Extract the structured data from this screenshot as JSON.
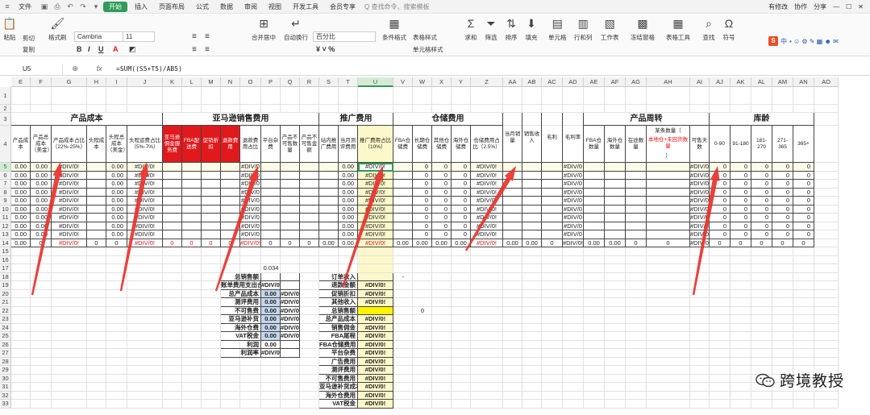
{
  "titlebar": {
    "menus": [
      "文件",
      "开始",
      "插入",
      "页面布局",
      "公式",
      "数据",
      "审阅",
      "视图",
      "开发工具",
      "会员专享"
    ],
    "active_menu": "开始",
    "search_placeholder": "Q 查找命令、搜索模板",
    "right_items": [
      "有修改",
      "协作",
      "分享"
    ]
  },
  "ribbon": {
    "paste": "粘贴",
    "cut": "剪切",
    "copy": "复制",
    "format_painter": "格式刷",
    "font_name": "Cambria",
    "font_size": "11",
    "merge": "合并居中",
    "wrap": "自动换行",
    "number_format": "百分比",
    "conditional": "条件格式",
    "table_style": "表格样式",
    "cell_style": "单元格样式",
    "sum": "求和",
    "filter": "筛选",
    "sort": "排序",
    "fill": "填充",
    "cell": "单元格",
    "row_col": "行和列",
    "worksheet": "工作表",
    "freeze": "冻结窗格",
    "table_tools": "表格工具",
    "find": "查找",
    "symbol": "符号",
    "wps_text": "中 ",
    "bold": "B",
    "italic": "I",
    "underline": "U"
  },
  "formula_bar": {
    "name_box": "U5",
    "formula": "=SUM((S5+T5)/AB5)"
  },
  "columns": [
    "E",
    "F",
    "G",
    "H",
    "I",
    "J",
    "K",
    "L",
    "M",
    "N",
    "O",
    "P",
    "Q",
    "R",
    "S",
    "T",
    "U",
    "V",
    "W",
    "X",
    "Y",
    "Z",
    "AA",
    "AB",
    "AC",
    "AD",
    "AE",
    "AF",
    "AG",
    "AH",
    "AI",
    "AJ",
    "AK",
    "AL",
    "AM",
    "AN",
    "AO"
  ],
  "rows": [
    "1",
    "2",
    "3",
    "4",
    "5",
    "6",
    "7",
    "8",
    "9",
    "10",
    "11",
    "12",
    "13",
    "14",
    "15",
    "16",
    "17",
    "18",
    "19",
    "20",
    "21",
    "22",
    "23",
    "24",
    "25",
    "26",
    "27",
    "28",
    "29",
    "30",
    "31",
    "32",
    "33"
  ],
  "headers": {
    "product_cost": "产品成本",
    "amazon_fee": "亚马逊销售费用",
    "promo_fee": "推广费用",
    "storage_fee": "仓储费用",
    "turnover": "产品周转",
    "aging": "库龄",
    "e4": "产品成本",
    "f4": "产品总成本（美金）",
    "g4": "产品成本占比（22%-25%）",
    "h4": "头程成本",
    "i4": "头程总成本（美金）",
    "j4": "头程运费占比（5%-7%）",
    "k4": "亚马逊佣金服务费",
    "l4": "FBA配送费",
    "m4": "促销折扣",
    "n4": "退款费用",
    "o4": "退款费用占比",
    "p4": "平台杂费",
    "q4": "产品不可售数量",
    "r4": "产品不可售金额",
    "s4": "站内推广费用",
    "t4": "当月测评费用",
    "u4": "推广费用占比（10%）",
    "v4": "FBA仓储费",
    "w4": "长期仓储费",
    "x4": "其他仓储费",
    "y4": "海外仓储费",
    "z4": "仓储费用占比（2.5%）",
    "aa4": "当月销量",
    "ab4": "销售收入",
    "ac4": "毛利",
    "ad4": "毛利率",
    "ae4": "FBA仓数量",
    "af4": "海外仓数量",
    "ag4": "在途数量",
    "ah4_a": "某条数量（",
    "ah4_b": "本地仓+未回货数量",
    "ah4_c": "）",
    "ai4": "可售天数",
    "aj4": "0-90",
    "ak4": "91-180",
    "al4": "181-270",
    "am4": "271-365",
    "an4": "365+"
  },
  "values": {
    "zero2": "0.00",
    "zero": "0",
    "div": "#DIV/0!",
    "div_trunc": "#DIV/0",
    "p17": "0.034"
  },
  "summary_left": {
    "labels": [
      "总销售额",
      "账单费用支出合计",
      "总产品成本",
      "测评费用",
      "不可售费",
      "亚马逊补货",
      "海外仓费",
      "VAT税金",
      "利润",
      "利润率"
    ],
    "vals": [
      "",
      "#DIV/0!",
      "0.00",
      "0.00",
      "0.00",
      "0.00",
      "0.00",
      "0.00",
      "0.00",
      "#DIV/0!"
    ],
    "vals2": [
      "",
      "",
      "#DIV/0!",
      "#DIV/0!",
      "#DIV/0!",
      "#DIV/0!",
      "#DIV/0!",
      "#DIV/0!",
      "",
      ""
    ]
  },
  "summary_right": {
    "labels": [
      "订单收入",
      "退款金额",
      "促销折扣",
      "其他收入",
      "总销售额",
      "总产品成本",
      "销售佣金",
      "FBA尾程",
      "FBA仓储费用",
      "平台杂费",
      "广告费用",
      "测评费用",
      "不可售费用",
      "亚马逊补货成本",
      "海外仓费用",
      "VAT税金"
    ],
    "vals": [
      "",
      "#DIV/0!",
      "#DIV/0!",
      "#DIV/0!",
      "",
      "#DIV/0!",
      "#DIV/0!",
      "#DIV/0!",
      "#DIV/0!",
      "#DIV/0!",
      "#DIV/0!",
      "#DIV/0!",
      "#DIV/0!",
      "#DIV/0!",
      "#DIV/0!",
      "#DIV/0!"
    ],
    "extra_zero": "0",
    "r18_mark": "-"
  },
  "watermark": {
    "text": "跨境教授"
  },
  "colors": {
    "accent": "#2f9b57",
    "header_red": "#e0191c",
    "yellow": "#fdf8c9",
    "arrow_red": "#e8322d"
  }
}
